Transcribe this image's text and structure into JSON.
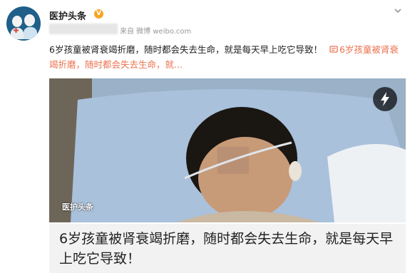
{
  "post": {
    "author": "医护头条",
    "verified_badge": "V",
    "source": "来自 微博 weibo.com",
    "text_main": "6岁孩童被肾衰竭折磨，随时都会失去生命，就是每天早上吃它导致！",
    "link_text": "6岁孩童被肾衰竭折磨，随时都会失去生命，就...",
    "icons": {
      "link": "link-icon",
      "menu": "chevron-down-icon",
      "video": "flash-icon"
    }
  },
  "card": {
    "watermark": "医护头条",
    "headline": "6岁孩童被肾衰竭折磨，随时都会失去生命，就是每天早上吃它导致！"
  },
  "colors": {
    "link": "#eb7350",
    "badge": "#f6a623",
    "avatar_bg": "#1f5f8a",
    "card_bg": "#f2f2f2"
  }
}
